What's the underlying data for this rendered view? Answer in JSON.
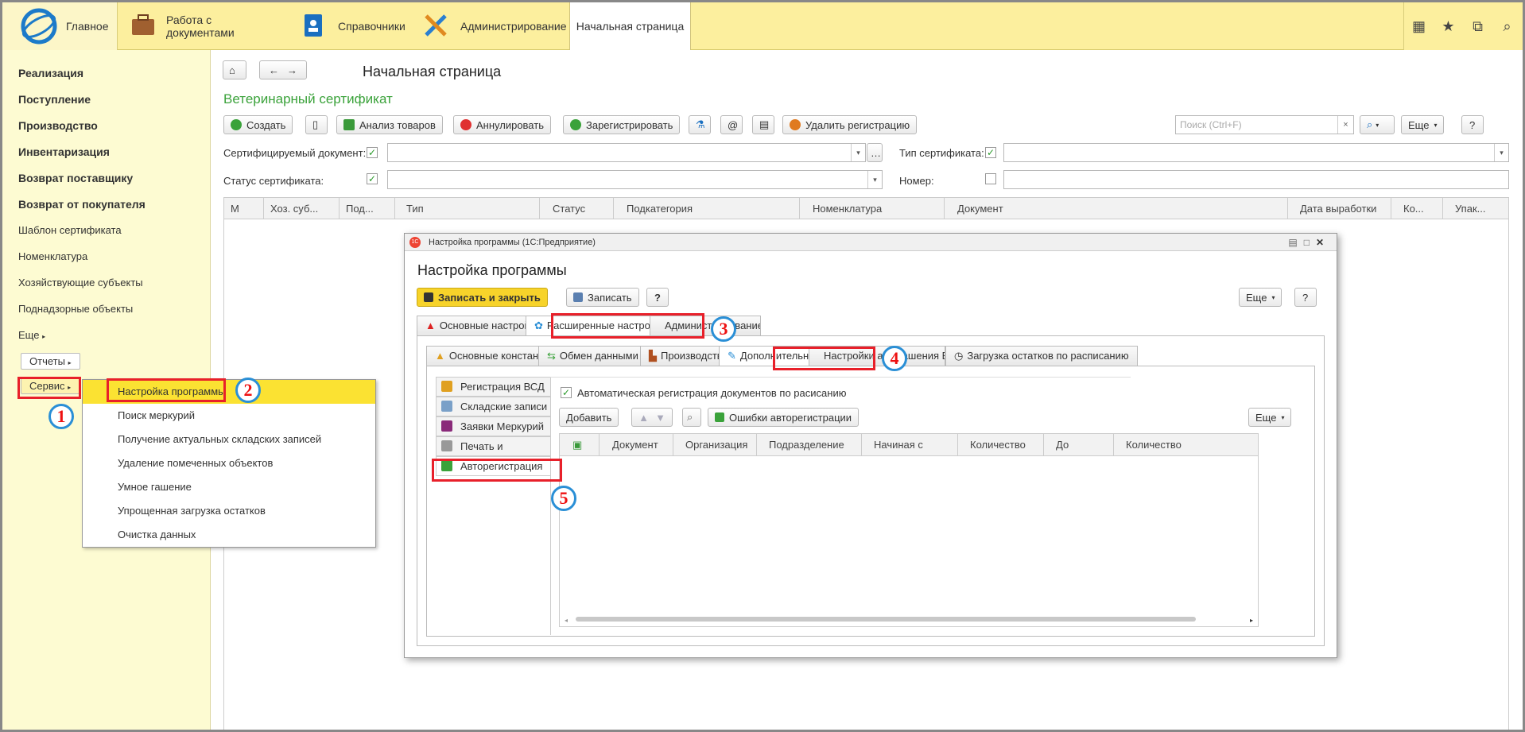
{
  "topbar": {
    "home_label": "Главное",
    "sections": [
      "Работа с документами",
      "Справочники",
      "Администрирование"
    ],
    "active_tab": "Начальная страница"
  },
  "sidebar": {
    "items": [
      "Реализация",
      "Поступление",
      "Производство",
      "Инвентаризация",
      "Возврат поставщику",
      "Возврат от покупателя",
      "Шаблон сертификата",
      "Номенклатура",
      "Хозяйствующие субъекты",
      "Поднадзорные объекты",
      "Еще"
    ],
    "reports_button": "Отчеты",
    "service_button": "Сервис"
  },
  "main": {
    "page_title": "Начальная страница",
    "section_title": "Ветеринарный сертификат",
    "toolbar": {
      "create": "Создать",
      "analyze": "Анализ товаров",
      "cancel": "Аннулировать",
      "register": "Зарегистрировать",
      "at": "@",
      "delete_reg": "Удалить регистрацию",
      "search_placeholder": "Поиск (Ctrl+F)",
      "more": "Еще",
      "help": "?"
    },
    "filters": {
      "cert_doc": "Сертифицируемый документ:",
      "cert_status": "Статус сертификата:",
      "cert_type": "Тип сертификата:",
      "number": "Номер:"
    },
    "columns": [
      "М",
      "Хоз. суб...",
      "Под...",
      "Тип",
      "Статус",
      "Подкатегория",
      "Номенклатура",
      "Документ",
      "Дата выработки",
      "Ко...",
      "Упак..."
    ]
  },
  "menu": {
    "items": [
      "Настройка программы",
      "Поиск меркурий",
      "Получение актуальных складских записей",
      "Удаление помеченных объектов",
      "Умное гашение",
      "Упрощенная загрузка остатков",
      "Очистка данных"
    ]
  },
  "dialog": {
    "window_title": "Настройка программы  (1С:Предприятие)",
    "title": "Настройка программы",
    "save_close": "Записать и закрыть",
    "save": "Записать",
    "help": "?",
    "more": "Еще",
    "tabs": [
      "Основные настройки",
      "Расширенные настройки",
      "Администрирование"
    ],
    "subtabs": [
      "Основные константы",
      "Обмен данными",
      "Производство",
      "Дополнительно",
      "Настройки автогашения ВСД",
      "Загрузка остатков по расписанию"
    ],
    "side_items": [
      "Регистрация ВСД",
      "Складские записи",
      "Заявки Меркурий",
      "Печать и рассылка",
      "Авторегистрация"
    ],
    "auto_reg_label": "Автоматическая регистрация документов по расисанию",
    "add_button": "Добавить",
    "errors_button": "Ошибки авторегистрации",
    "columns": [
      "Документ",
      "Организация",
      "Подразделение",
      "Начиная с",
      "Количество",
      "До",
      "Количество"
    ]
  },
  "annotations": [
    "1",
    "2",
    "3",
    "4",
    "5"
  ],
  "colors": {
    "topbar": "#fcef9e",
    "sidebar": "#fdfbd2",
    "section_title": "#3aa23a",
    "highlight": "#fbe232",
    "annotation_box": "#e8202a",
    "annotation_circle": "#2a8fd6"
  }
}
